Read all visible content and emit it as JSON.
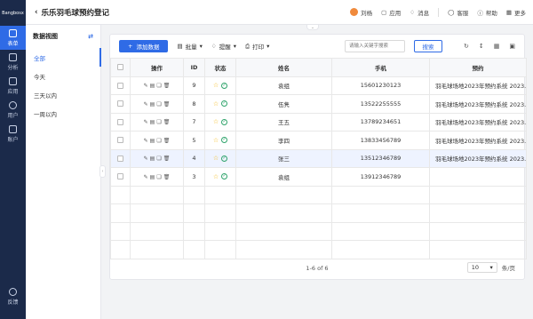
{
  "rail": {
    "logo": "Bangbosx",
    "items": [
      {
        "label": "表单",
        "active": true
      },
      {
        "label": "分析"
      },
      {
        "label": "应用"
      },
      {
        "label": "用户"
      },
      {
        "label": "账户"
      }
    ],
    "bottom": "反馈"
  },
  "header": {
    "back_title": "乐乐羽毛球预约登记",
    "user": "刘杨",
    "apps": "应用",
    "messages": "消息",
    "service": "客服",
    "help": "帮助",
    "more": "更多"
  },
  "sidebar": {
    "title": "数据视图",
    "views": [
      "全部",
      "今天",
      "三天以内",
      "一周以内"
    ]
  },
  "toolbar": {
    "add_label": "添加数据",
    "batch_label": "批量",
    "remind_label": "提醒",
    "print_label": "打印",
    "search_placeholder": "请输入关键字搜索",
    "search_label": "搜索"
  },
  "table": {
    "columns": [
      "操作",
      "ID",
      "状态",
      "姓名",
      "手机",
      "预约"
    ],
    "rows": [
      {
        "id": "9",
        "name": "袁组",
        "phone": "15601230123",
        "booking": "羽毛球场地2023年预约系统 2023..."
      },
      {
        "id": "8",
        "name": "伍隽",
        "phone": "13522255555",
        "booking": "羽毛球场地2023年预约系统 2023..."
      },
      {
        "id": "7",
        "name": "王五",
        "phone": "13789234651",
        "booking": "羽毛球场地2023年预约系统 2023..."
      },
      {
        "id": "5",
        "name": "李四",
        "phone": "13833456789",
        "booking": "羽毛球场地2023年预约系统 2023..."
      },
      {
        "id": "4",
        "name": "张三",
        "phone": "13512346789",
        "booking": "羽毛球场地2023年预约系统 2023..."
      },
      {
        "id": "3",
        "name": "袁组",
        "phone": "13912346789",
        "booking": ""
      }
    ]
  },
  "footer": {
    "range": "1-6 of 6",
    "page_size": "10",
    "per_page": "条/页"
  },
  "colors": {
    "primary": "#2f6be6",
    "rail": "#1b2a4a"
  }
}
